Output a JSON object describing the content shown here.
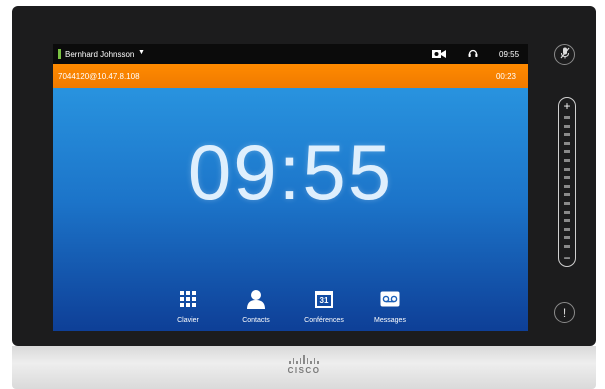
{
  "status_bar": {
    "user_name": "Bernhard Johnsson",
    "dropdown_glyph": "▼",
    "time": "09:55",
    "icons": [
      "camera-icon",
      "headset-icon"
    ]
  },
  "call_bar": {
    "address": "7044120@10.47.8.108",
    "duration": "00:23",
    "color": "#f58200"
  },
  "main": {
    "clock": "09:55"
  },
  "toolbar": {
    "items": [
      {
        "label": "Clavier",
        "icon": "keypad-icon"
      },
      {
        "label": "Contacts",
        "icon": "contact-person-icon"
      },
      {
        "label": "Conférences",
        "icon": "calendar-icon",
        "icon_text": "31"
      },
      {
        "label": "Messages",
        "icon": "voicemail-icon"
      }
    ]
  },
  "side_controls": {
    "mute_icon": "microphone-muted-icon",
    "volume_plus": "+",
    "volume_minus": "−",
    "alert_glyph": "!"
  },
  "brand": {
    "name": "CISCO"
  }
}
